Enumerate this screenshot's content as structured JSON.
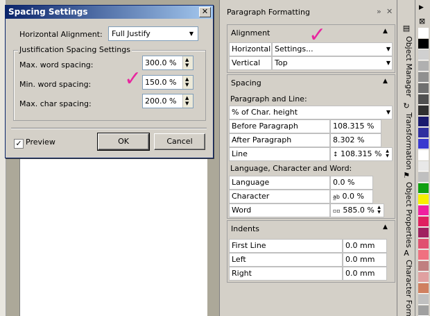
{
  "dialog": {
    "title": "Spacing Settings",
    "close_glyph": "✕",
    "horizontal_alignment_label": "Horizontal Alignment:",
    "horizontal_alignment_value": "Full Justify",
    "group_title": "Justification Spacing Settings",
    "fields": [
      {
        "label": "Max. word spacing:",
        "value": "300.0 %"
      },
      {
        "label": "Min. word spacing:",
        "value": "150.0 %"
      },
      {
        "label": "Max. char spacing:",
        "value": "200.0 %"
      }
    ],
    "preview_label": "Preview",
    "preview_checked": true,
    "ok_label": "OK",
    "cancel_label": "Cancel"
  },
  "panel": {
    "title": "Paragraph Formatting",
    "alignment": {
      "header": "Alignment",
      "horizontal_label": "Horizontal",
      "horizontal_value": "Settings...",
      "vertical_label": "Vertical",
      "vertical_value": "Top"
    },
    "spacing": {
      "header": "Spacing",
      "paragraph_line_label": "Paragraph and Line:",
      "unit_value": "% of Char. height",
      "rows": [
        {
          "label": "Before Paragraph",
          "value": "108.315 %"
        },
        {
          "label": "After Paragraph",
          "value": "8.302 %"
        },
        {
          "label": "Line",
          "value": "108.315 %"
        }
      ],
      "lang_label": "Language, Character and Word:",
      "rows2": [
        {
          "label": "Language",
          "value": "0.0 %"
        },
        {
          "label": "Character",
          "value": "0.0 %"
        },
        {
          "label": "Word",
          "value": "585.0 %"
        }
      ]
    },
    "indents": {
      "header": "Indents",
      "rows": [
        {
          "label": "First Line",
          "value": "0.0 mm"
        },
        {
          "label": "Left",
          "value": "0.0 mm"
        },
        {
          "label": "Right",
          "value": "0.0 mm"
        }
      ]
    }
  },
  "tabs": [
    {
      "label": "Object Manager"
    },
    {
      "label": "Transformation"
    },
    {
      "label": "Object Properties"
    },
    {
      "label": "Character Formatting"
    }
  ],
  "palette_colors": [
    "#ffffff",
    "#000000",
    "#d0d0d0",
    "#b0b0b0",
    "#909090",
    "#707070",
    "#505050",
    "#303030",
    "#1a1a6e",
    "#2f2f9f",
    "#3a3acf",
    "#ffffff",
    "#e8e8e8",
    "#c0c0c0",
    "#10a010",
    "#f8f000",
    "#f020a0",
    "#e02060",
    "#a02060",
    "#e05070",
    "#f07080",
    "#c08080",
    "#e0a0a0",
    "#d08060",
    "#c0c0c0",
    "#a0a0a0"
  ]
}
